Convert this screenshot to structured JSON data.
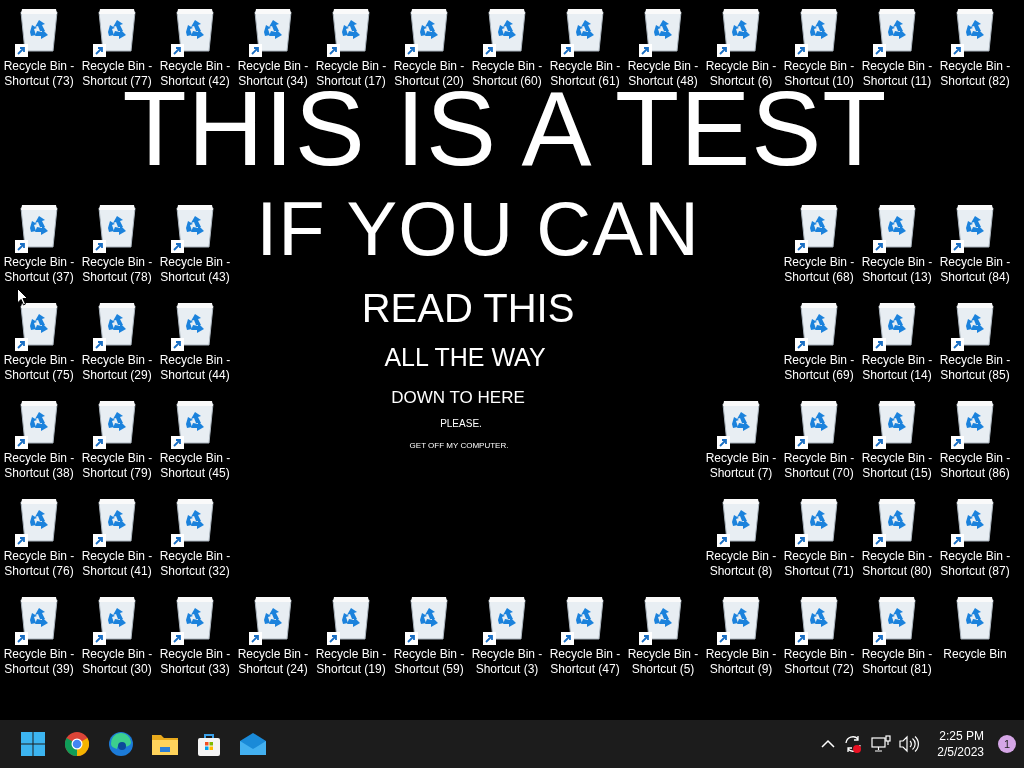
{
  "wallpaper": {
    "lines": [
      "THIS IS A TEST",
      "IF YOU CAN",
      "READ THIS",
      "ALL THE WAY",
      "DOWN TO HERE",
      "PLEASE.",
      "GET OFF MY COMPUTER."
    ]
  },
  "top_row": [
    {
      "label": "Recycle Bin - Shortcut (73)",
      "shortcut": true
    },
    {
      "label": "Recycle Bin - Shortcut (77)",
      "shortcut": true
    },
    {
      "label": "Recycle Bin - Shortcut (42)",
      "shortcut": true
    },
    {
      "label": "Recycle Bin - Shortcut (34)",
      "shortcut": true
    },
    {
      "label": "Recycle Bin - Shortcut (17)",
      "shortcut": true
    },
    {
      "label": "Recycle Bin - Shortcut (20)",
      "shortcut": true
    },
    {
      "label": "Recycle Bin - Shortcut (60)",
      "shortcut": true
    },
    {
      "label": "Recycle Bin - Shortcut (61)",
      "shortcut": true
    },
    {
      "label": "Recycle Bin - Shortcut (48)",
      "shortcut": true
    },
    {
      "label": "Recycle Bin - Shortcut (6)",
      "shortcut": true
    },
    {
      "label": "Recycle Bin - Shortcut (10)",
      "shortcut": true
    },
    {
      "label": "Recycle Bin - Shortcut (11)",
      "shortcut": true
    },
    {
      "label": "Recycle Bin - Shortcut (82)",
      "shortcut": true
    }
  ],
  "side_rows": [
    {
      "left": [
        {
          "label": "Recycle Bin - Shortcut (37)",
          "shortcut": true
        },
        {
          "label": "Recycle Bin - Shortcut (78)",
          "shortcut": true
        },
        {
          "label": "Recycle Bin - Shortcut (43)",
          "shortcut": true
        }
      ],
      "right": [
        {
          "label": "Recycle Bin - Shortcut (68)",
          "shortcut": true
        },
        {
          "label": "Recycle Bin - Shortcut (13)",
          "shortcut": true
        },
        {
          "label": "Recycle Bin - Shortcut (84)",
          "shortcut": true
        }
      ]
    },
    {
      "left": [
        {
          "label": "Recycle Bin - Shortcut (75)",
          "shortcut": true
        },
        {
          "label": "Recycle Bin - Shortcut (29)",
          "shortcut": true
        },
        {
          "label": "Recycle Bin - Shortcut (44)",
          "shortcut": true
        }
      ],
      "right": [
        {
          "label": "Recycle Bin - Shortcut (69)",
          "shortcut": true
        },
        {
          "label": "Recycle Bin - Shortcut (14)",
          "shortcut": true
        },
        {
          "label": "Recycle Bin - Shortcut (85)",
          "shortcut": true
        }
      ]
    },
    {
      "left": [
        {
          "label": "Recycle Bin - Shortcut (38)",
          "shortcut": true
        },
        {
          "label": "Recycle Bin - Shortcut (79)",
          "shortcut": true
        },
        {
          "label": "Recycle Bin - Shortcut (45)",
          "shortcut": true
        }
      ],
      "right": [
        {
          "label": "Recycle Bin - Shortcut (7)",
          "shortcut": true
        },
        {
          "label": "Recycle Bin - Shortcut (70)",
          "shortcut": true
        },
        {
          "label": "Recycle Bin - Shortcut (15)",
          "shortcut": true
        },
        {
          "label": "Recycle Bin - Shortcut (86)",
          "shortcut": true
        }
      ]
    },
    {
      "left": [
        {
          "label": "Recycle Bin - Shortcut (76)",
          "shortcut": true
        },
        {
          "label": "Recycle Bin - Shortcut (41)",
          "shortcut": true
        },
        {
          "label": "Recycle Bin - Shortcut (32)",
          "shortcut": true
        }
      ],
      "right": [
        {
          "label": "Recycle Bin - Shortcut (8)",
          "shortcut": true
        },
        {
          "label": "Recycle Bin - Shortcut (71)",
          "shortcut": true
        },
        {
          "label": "Recycle Bin - Shortcut (80)",
          "shortcut": true
        },
        {
          "label": "Recycle Bin - Shortcut (87)",
          "shortcut": true
        }
      ]
    }
  ],
  "bottom_row": [
    {
      "label": "Recycle Bin - Shortcut (39)",
      "shortcut": true
    },
    {
      "label": "Recycle Bin - Shortcut (30)",
      "shortcut": true
    },
    {
      "label": "Recycle Bin - Shortcut (33)",
      "shortcut": true
    },
    {
      "label": "Recycle Bin - Shortcut (24)",
      "shortcut": true
    },
    {
      "label": "Recycle Bin - Shortcut (19)",
      "shortcut": true
    },
    {
      "label": "Recycle Bin - Shortcut (59)",
      "shortcut": true
    },
    {
      "label": "Recycle Bin - Shortcut (3)",
      "shortcut": true
    },
    {
      "label": "Recycle Bin - Shortcut (47)",
      "shortcut": true
    },
    {
      "label": "Recycle Bin - Shortcut (5)",
      "shortcut": true
    },
    {
      "label": "Recycle Bin - Shortcut (9)",
      "shortcut": true
    },
    {
      "label": "Recycle Bin - Shortcut (72)",
      "shortcut": true
    },
    {
      "label": "Recycle Bin - Shortcut (81)",
      "shortcut": true
    },
    {
      "label": "Recycle Bin",
      "shortcut": false
    }
  ],
  "taskbar": {
    "apps": [
      {
        "kind": "start"
      },
      {
        "kind": "chrome"
      },
      {
        "kind": "edge"
      },
      {
        "kind": "explorer"
      },
      {
        "kind": "store"
      },
      {
        "kind": "mail"
      }
    ],
    "tray": {
      "time": "2:25 PM",
      "date": "2/5/2023",
      "notifications": "1"
    }
  }
}
